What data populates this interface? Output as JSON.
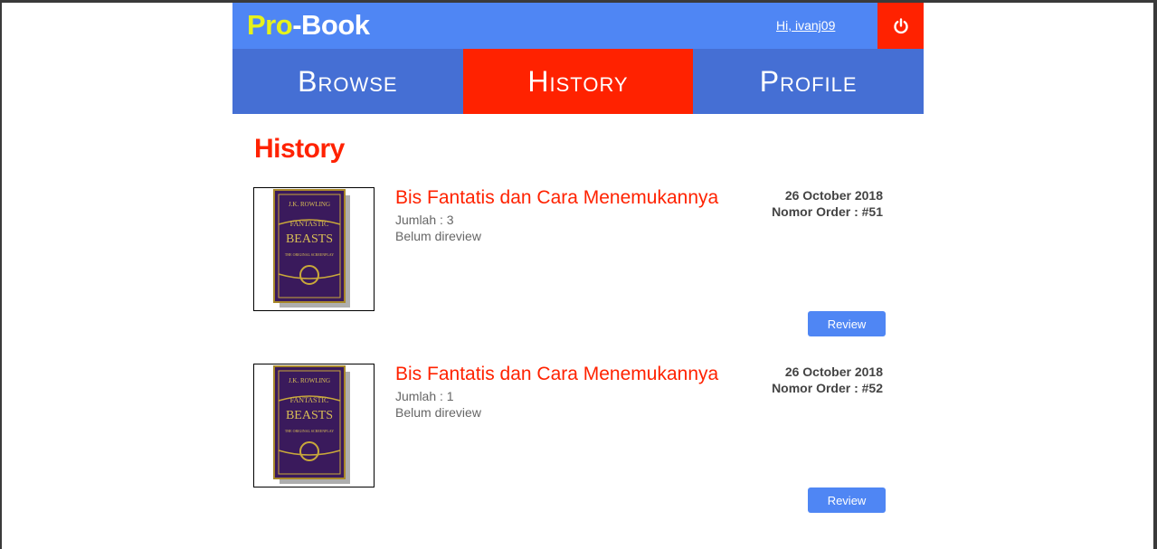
{
  "header": {
    "logo_pro": "Pro",
    "logo_book": "-Book",
    "greeting": "Hi, ivanj09",
    "logout_icon": "power-icon"
  },
  "nav": {
    "tabs": [
      {
        "label": "Browse",
        "active": false
      },
      {
        "label": "History",
        "active": true
      },
      {
        "label": "Profile",
        "active": false
      }
    ]
  },
  "page": {
    "title": "History"
  },
  "orders": [
    {
      "title": "Bis Fantatis dan Cara Menemukannya",
      "quantity": "Jumlah : 3",
      "status": "Belum direview",
      "date": "26 October 2018",
      "order_number": "Nomor Order : #51",
      "button": "Review",
      "cover": {
        "author": "J.K. ROWLING",
        "line1": "FANTASTIC",
        "line2": "BEASTS",
        "line3": "THE ORIGINAL SCREENPLAY"
      }
    },
    {
      "title": "Bis Fantatis dan Cara Menemukannya",
      "quantity": "Jumlah : 1",
      "status": "Belum direview",
      "date": "26 October 2018",
      "order_number": "Nomor Order : #52",
      "button": "Review",
      "cover": {
        "author": "J.K. ROWLING",
        "line1": "FANTASTIC",
        "line2": "BEASTS",
        "line3": "THE ORIGINAL SCREENPLAY"
      }
    }
  ],
  "colors": {
    "header_bg": "#4f86f4",
    "nav_bg": "#456fd4",
    "accent_red": "#ff2200",
    "logo_yellow": "#e6f21b",
    "button_blue": "#4f86f4"
  }
}
